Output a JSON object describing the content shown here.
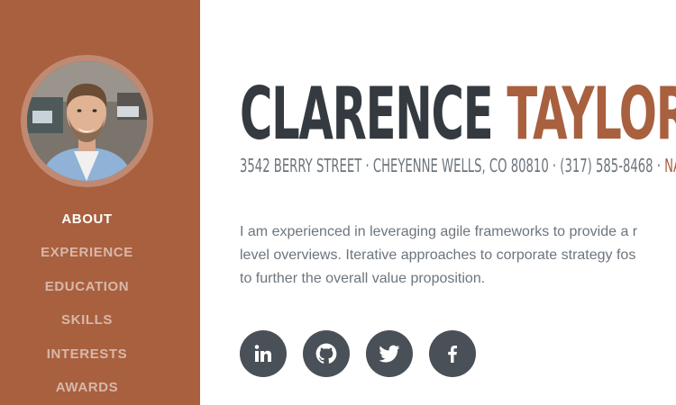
{
  "sidebar": {
    "nav": [
      {
        "label": "ABOUT"
      },
      {
        "label": "EXPERIENCE"
      },
      {
        "label": "EDUCATION"
      },
      {
        "label": "SKILLS"
      },
      {
        "label": "INTERESTS"
      },
      {
        "label": "AWARDS"
      }
    ],
    "active_index": 0
  },
  "main": {
    "first_name": "CLARENCE",
    "last_name": "TAYLOR",
    "address": "3542 BERRY STREET · CHEYENNE WELLS, CO 80810 · (317) 585-8468 · ",
    "email": "NAME",
    "intro_lines": [
      "I am experienced in leveraging agile frameworks to provide a r",
      "level overviews. Iterative approaches to corporate strategy fos",
      "to further the overall value proposition."
    ],
    "social": [
      {
        "icon": "linkedin-icon"
      },
      {
        "icon": "github-icon"
      },
      {
        "icon": "twitter-icon"
      },
      {
        "icon": "facebook-icon"
      }
    ]
  },
  "colors": {
    "sidebar": "#a8603f",
    "accent": "#a8603f",
    "heading": "#343a40",
    "text": "#6c757d",
    "social": "#495057"
  }
}
